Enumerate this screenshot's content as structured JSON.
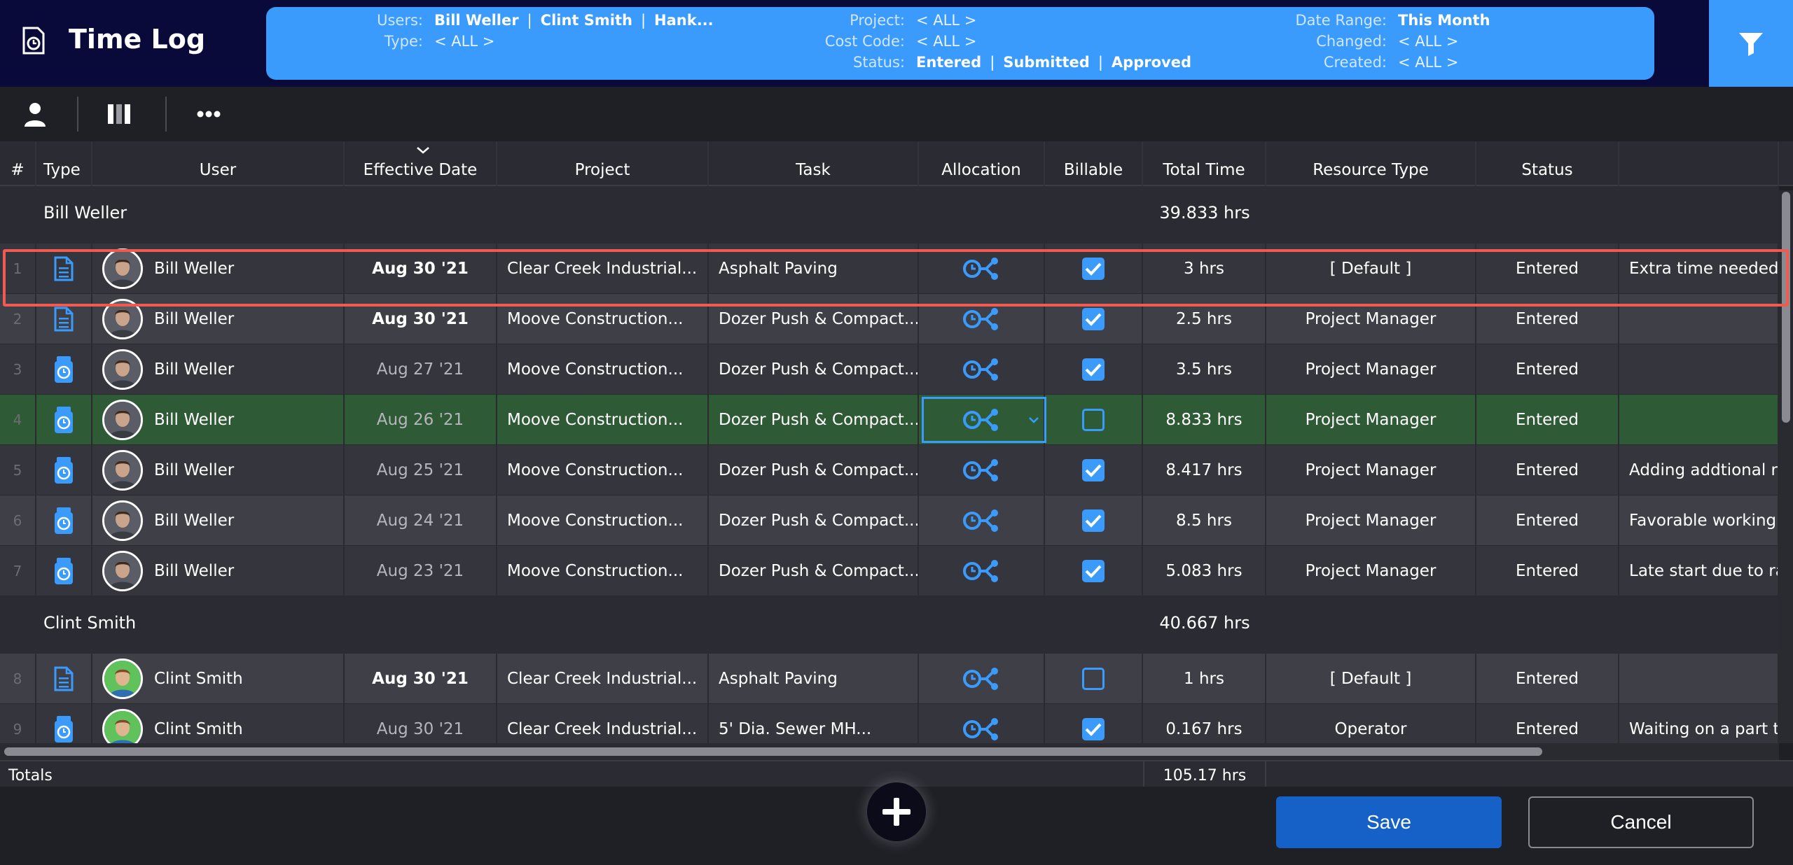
{
  "header": {
    "title": "Time Log",
    "app_icon": "clock-document-icon",
    "filter_icon": "filter-icon"
  },
  "filters": {
    "users": {
      "label": "Users:",
      "values": [
        "Bill Weller",
        "Clint Smith",
        "Hank..."
      ]
    },
    "type": {
      "label": "Type:",
      "value": "< ALL >"
    },
    "project": {
      "label": "Project:",
      "value": "< ALL >"
    },
    "cost_code": {
      "label": "Cost Code:",
      "value": "< ALL >"
    },
    "status": {
      "label": "Status:",
      "values": [
        "Entered",
        "Submitted",
        "Approved"
      ]
    },
    "date_range": {
      "label": "Date Range:",
      "value": "This Month"
    },
    "changed": {
      "label": "Changed:",
      "value": "< ALL >"
    },
    "created": {
      "label": "Created:",
      "value": "< ALL >"
    }
  },
  "toolbar": {
    "icons": [
      "user-icon",
      "columns-icon",
      "more-icon"
    ]
  },
  "columns": [
    "#",
    "Type",
    "User",
    "Effective Date",
    "Project",
    "Task",
    "Allocation",
    "Billable",
    "Total Time",
    "Resource Type",
    "Status"
  ],
  "groups": [
    {
      "name": "Bill Weller",
      "total": "39.833 hrs",
      "rows": [
        {
          "num": "1",
          "type": "document",
          "user": "Bill Weller",
          "date": "Aug 30 '21",
          "project": "Clear Creek Industrial...",
          "task": "Asphalt Paving",
          "billable": true,
          "total": "3 hrs",
          "resource": "[ Default ]",
          "status": "Entered",
          "notes": "Extra time needed"
        },
        {
          "num": "2",
          "type": "document",
          "user": "Bill Weller",
          "date": "Aug 30 '21",
          "project": "Moove Construction...",
          "task": "Dozer Push & Compact...",
          "billable": true,
          "total": "2.5 hrs",
          "resource": "Project Manager",
          "status": "Entered",
          "notes": ""
        },
        {
          "num": "3",
          "type": "timer",
          "user": "Bill Weller",
          "date": "Aug 27 '21",
          "project": "Moove Construction...",
          "task": "Dozer Push & Compact...",
          "billable": true,
          "total": "3.5 hrs",
          "resource": "Project Manager",
          "status": "Entered",
          "notes": ""
        },
        {
          "num": "4",
          "type": "timer",
          "user": "Bill Weller",
          "date": "Aug 26 '21",
          "project": "Moove Construction...",
          "task": "Dozer Push & Compact...",
          "billable": false,
          "total": "8.833 hrs",
          "resource": "Project Manager",
          "status": "Entered",
          "notes": ""
        },
        {
          "num": "5",
          "type": "timer",
          "user": "Bill Weller",
          "date": "Aug 25 '21",
          "project": "Moove Construction...",
          "task": "Dozer Push & Compact...",
          "billable": true,
          "total": "8.417 hrs",
          "resource": "Project Manager",
          "status": "Entered",
          "notes": "Adding addtional re"
        },
        {
          "num": "6",
          "type": "timer",
          "user": "Bill Weller",
          "date": "Aug 24 '21",
          "project": "Moove Construction...",
          "task": "Dozer Push & Compact...",
          "billable": true,
          "total": "8.5 hrs",
          "resource": "Project Manager",
          "status": "Entered",
          "notes": "Favorable working"
        },
        {
          "num": "7",
          "type": "timer",
          "user": "Bill Weller",
          "date": "Aug 23 '21",
          "project": "Moove Construction...",
          "task": "Dozer Push & Compact...",
          "billable": true,
          "total": "5.083 hrs",
          "resource": "Project Manager",
          "status": "Entered",
          "notes": "Late start due to ra"
        }
      ]
    },
    {
      "name": "Clint Smith",
      "total": "40.667 hrs",
      "rows": [
        {
          "num": "8",
          "type": "document",
          "user": "Clint Smith",
          "date": "Aug 30 '21",
          "project": "Clear Creek Industrial...",
          "task": "Asphalt Paving",
          "billable": false,
          "total": "1 hrs",
          "resource": "[ Default ]",
          "status": "Entered",
          "notes": ""
        },
        {
          "num": "9",
          "type": "timer",
          "user": "Clint Smith",
          "date": "Aug 30 '21",
          "project": "Clear Creek Industrial...",
          "task": "5' Dia. Sewer MH...",
          "billable": true,
          "total": "0.167 hrs",
          "resource": "Operator",
          "status": "Entered",
          "notes": "Waiting on a part to"
        }
      ]
    }
  ],
  "totals": {
    "label": "Totals",
    "value": "105.17 hrs"
  },
  "footer": {
    "save_label": "Save",
    "cancel_label": "Cancel",
    "add_icon": "plus-icon"
  },
  "colors": {
    "accent": "#3a9bfc",
    "header_bg": "#0a0a3a",
    "selected_row": "#2f5a36",
    "highlight": "#f05a4f",
    "save": "#1561c8"
  }
}
